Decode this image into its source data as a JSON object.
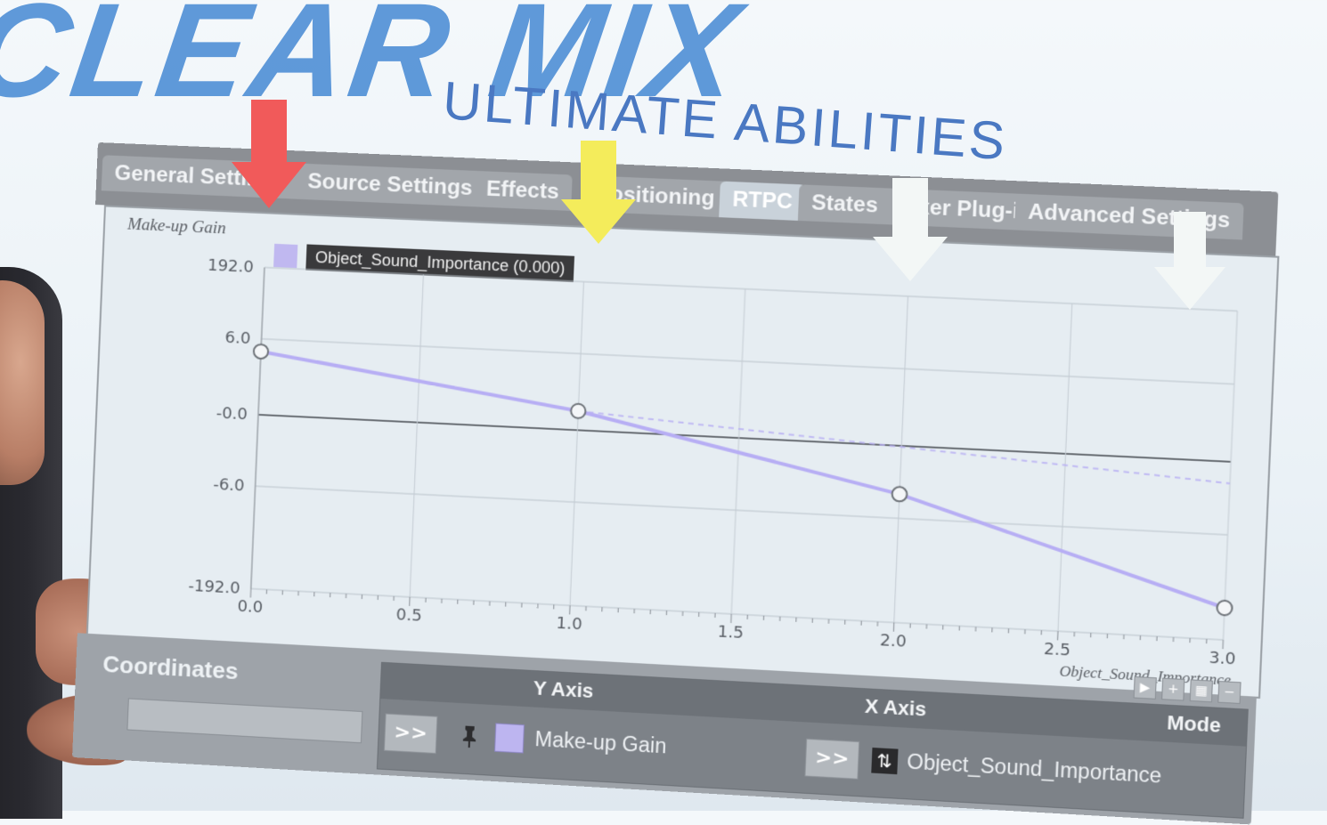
{
  "slide": {
    "brand_text": "CLEAR MIX",
    "title": "ULTIMATE ABILITIES"
  },
  "tabs": [
    {
      "label": "General Settings"
    },
    {
      "label": "Source Settings"
    },
    {
      "label": "Effects"
    },
    {
      "label": "Positioning"
    },
    {
      "label": "RTPC",
      "active": true
    },
    {
      "label": "States"
    },
    {
      "label": "Mixer Plug-in"
    },
    {
      "label": "Advanced Settings"
    }
  ],
  "graph": {
    "y_axis_label": "Make-up Gain",
    "x_axis_label": "Object_Sound_Importance",
    "legend_label": "Object_Sound_Importance (0.000)",
    "y_tick_labels": [
      "192.0",
      "6.0",
      "-0.0",
      "-6.0",
      "-192.0"
    ],
    "x_tick_labels": [
      "0.0",
      "0.5",
      "1.0",
      "1.5",
      "2.0",
      "2.5",
      "3.0"
    ],
    "curve_color": "#b7aef4"
  },
  "chart_data": {
    "type": "line",
    "x": [
      0.0,
      1.0,
      2.0,
      3.0
    ],
    "series": [
      {
        "values": [
          5.0,
          1.5,
          -4.0,
          -12.0
        ]
      }
    ],
    "xlim": [
      0.0,
      3.0
    ],
    "y_ticks": [
      "192.0",
      "6.0",
      "-0.0",
      "-6.0",
      "-192.0"
    ],
    "grid": true
  },
  "bottom_panel": {
    "coordinates_label": "Coordinates",
    "columns": {
      "y_axis": "Y Axis",
      "x_axis": "X Axis",
      "mode": "Mode"
    },
    "row": {
      "expand_label": ">>",
      "y_axis_value": "Make-up Gain",
      "expand_label_2": ">>",
      "x_axis_value": "Object_Sound_Importance"
    },
    "icons": {
      "pin": "pin-icon",
      "rtpc": "rtpc-icon"
    }
  },
  "annotations": {
    "arrow_colors": [
      "#f15a5a",
      "#f4ec5b",
      "#f3f7f6",
      "#f3f7f6"
    ]
  }
}
